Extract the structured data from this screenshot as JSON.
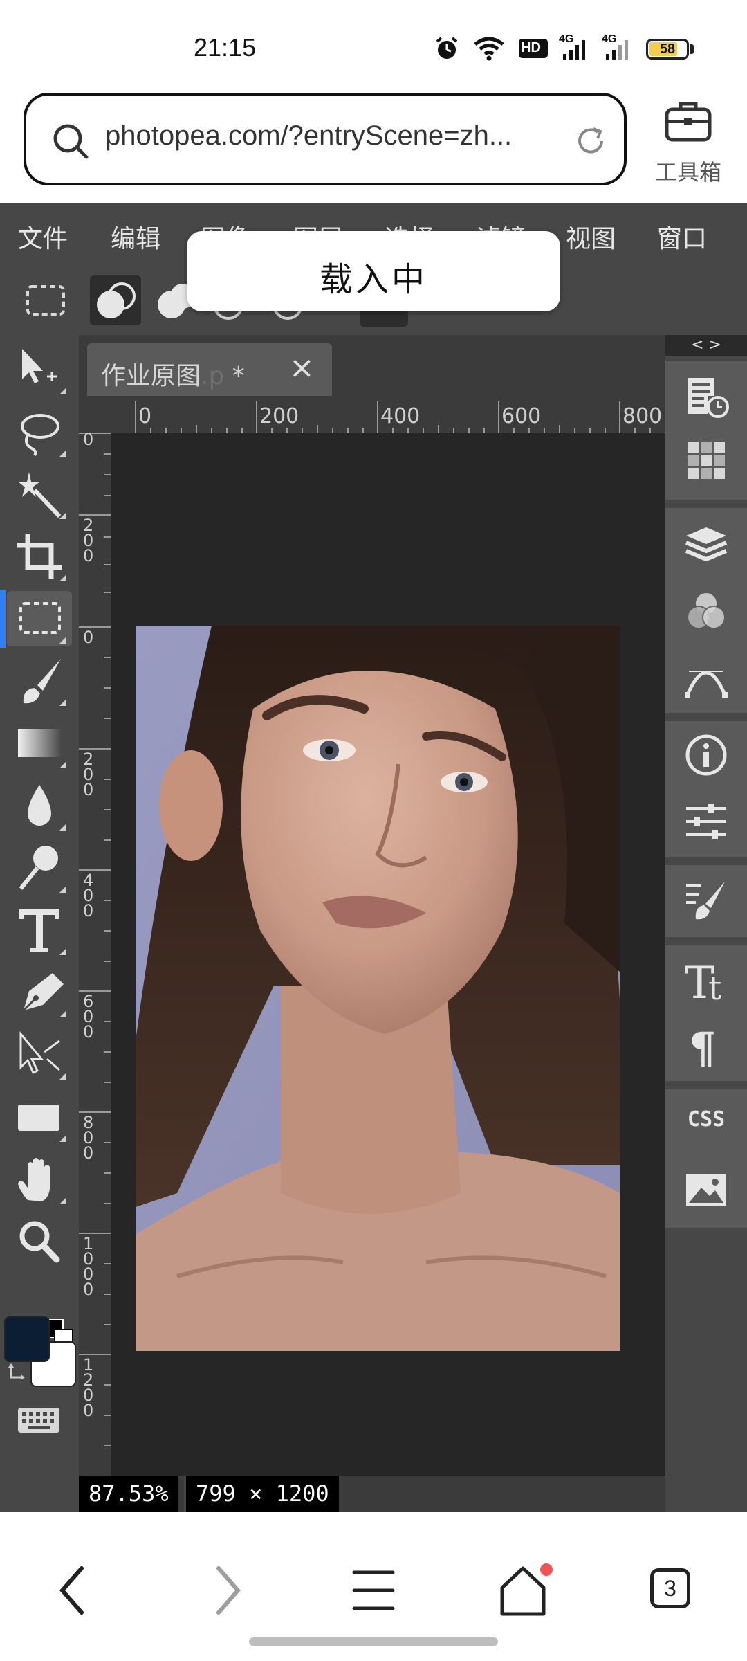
{
  "status_bar": {
    "time": "21:15",
    "icons": [
      "alarm-icon",
      "wifi-icon",
      "hd-icon",
      "signal-4g-icon",
      "signal-4g-icon"
    ],
    "hd_label": "HD",
    "network_label": "4G",
    "battery": "58",
    "battery_color": "#f2cd4e"
  },
  "browser": {
    "url": "photopea.com/?entryScene=zh...",
    "toolbox_label": "工具箱"
  },
  "photopea": {
    "menu": [
      "文件",
      "编辑",
      "图像",
      "图层",
      "选择",
      "滤镜",
      "视图",
      "窗口"
    ],
    "loading_toast": "载入中",
    "document_tab": {
      "title": "作业原图",
      "ext": ".p",
      "modified": " *",
      "close": "×"
    },
    "ruler_h": [
      "0",
      "200",
      "400",
      "600",
      "800"
    ],
    "ruler_v": [
      "0",
      "200",
      "0",
      "200",
      "400",
      "600",
      "800",
      "1000",
      "1200"
    ],
    "zoom": "87.53%",
    "doc_size": "799 × 1200",
    "panel_toggle": "< >",
    "css_label": "CSS",
    "tools": [
      "move-tool",
      "lasso-tool",
      "magic-wand-tool",
      "crop-tool",
      "marquee-tool",
      "brush-tool",
      "gradient-tool",
      "blur-tool",
      "dodge-tool",
      "type-tool",
      "pen-tool",
      "path-select-tool",
      "shape-tool",
      "hand-tool",
      "zoom-tool"
    ],
    "foreground_color": "#0b1e33",
    "background_color": "#ffffff",
    "accent_color": "#2f7ff6"
  },
  "bottom_nav": {
    "tabs_count": "3"
  }
}
